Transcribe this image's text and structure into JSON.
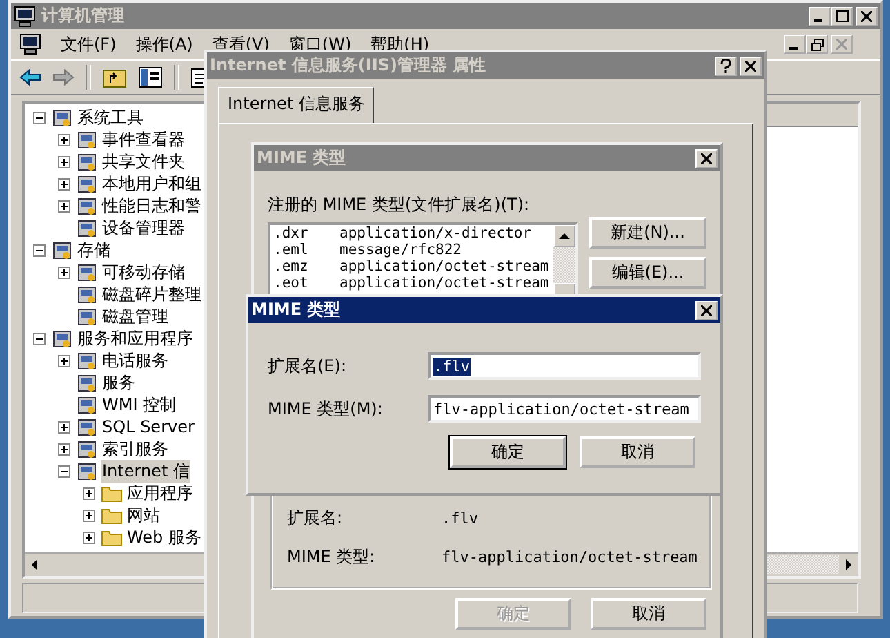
{
  "main_window": {
    "title": "计算机管理",
    "menu": [
      "文件(F)",
      "操作(A)",
      "查看(V)",
      "窗口(W)",
      "帮助(H)"
    ],
    "tree": [
      {
        "label": "系统工具",
        "expanded": true,
        "selected": false,
        "children": [
          {
            "label": "事件查看器",
            "expanded": false,
            "selected": false
          },
          {
            "label": "共享文件夹",
            "expanded": false,
            "selected": false
          },
          {
            "label": "本地用户和组",
            "expanded": false,
            "selected": false
          },
          {
            "label": "性能日志和警",
            "expanded": false,
            "selected": false
          },
          {
            "label": "设备管理器",
            "selected": false
          }
        ]
      },
      {
        "label": "存储",
        "expanded": true,
        "selected": false,
        "children": [
          {
            "label": "可移动存储",
            "expanded": false,
            "selected": false
          },
          {
            "label": "磁盘碎片整理",
            "selected": false
          },
          {
            "label": "磁盘管理",
            "selected": false
          }
        ]
      },
      {
        "label": "服务和应用程序",
        "expanded": true,
        "selected": false,
        "children": [
          {
            "label": "电话服务",
            "expanded": false,
            "selected": false
          },
          {
            "label": "服务",
            "selected": false
          },
          {
            "label": "WMI 控制",
            "selected": false
          },
          {
            "label": "SQL Server",
            "expanded": false,
            "selected": false
          },
          {
            "label": "索引服务",
            "expanded": false,
            "selected": false
          },
          {
            "label": "Internet 信",
            "expanded": true,
            "selected": true,
            "children": [
              {
                "label": "应用程序",
                "expanded": false,
                "selected": false
              },
              {
                "label": "网站",
                "expanded": false,
                "selected": false
              },
              {
                "label": "Web 服务",
                "expanded": false,
                "selected": false
              }
            ]
          }
        ]
      }
    ]
  },
  "properties_dialog": {
    "title": "Internet 信息服务(IIS)管理器 属性",
    "tabs": [
      {
        "label": "Internet 信息服务",
        "selected": true
      }
    ]
  },
  "mime_dialog": {
    "title": "MIME 类型",
    "list_label": "注册的 MIME 类型(文件扩展名)(T):",
    "types": [
      {
        "extension": ".dxr",
        "type": "application/x-director"
      },
      {
        "extension": ".eml",
        "type": "message/rfc822"
      },
      {
        "extension": ".emz",
        "type": "application/octet-stream"
      },
      {
        "extension": ".eot",
        "type": "application/octet-stream"
      }
    ],
    "side_buttons": [
      "新建(N)...",
      "编辑(E)..."
    ],
    "details": [
      {
        "label": "扩展名:",
        "value": ".flv"
      },
      {
        "label": "MIME 类型:",
        "value": "flv-application/octet-stream"
      }
    ],
    "buttons": [
      {
        "label": "确定",
        "disabled": true
      },
      {
        "label": "取消",
        "disabled": false
      }
    ]
  },
  "edit_dialog": {
    "title": "MIME 类型",
    "fields": [
      {
        "label": "扩展名(E):",
        "value": ".flv",
        "selected": true
      },
      {
        "label": "MIME 类型(M):",
        "value": "flv-application/octet-stream",
        "selected": false
      }
    ],
    "buttons": [
      {
        "label": "确定",
        "default": true
      },
      {
        "label": "取消",
        "default": false
      }
    ]
  }
}
